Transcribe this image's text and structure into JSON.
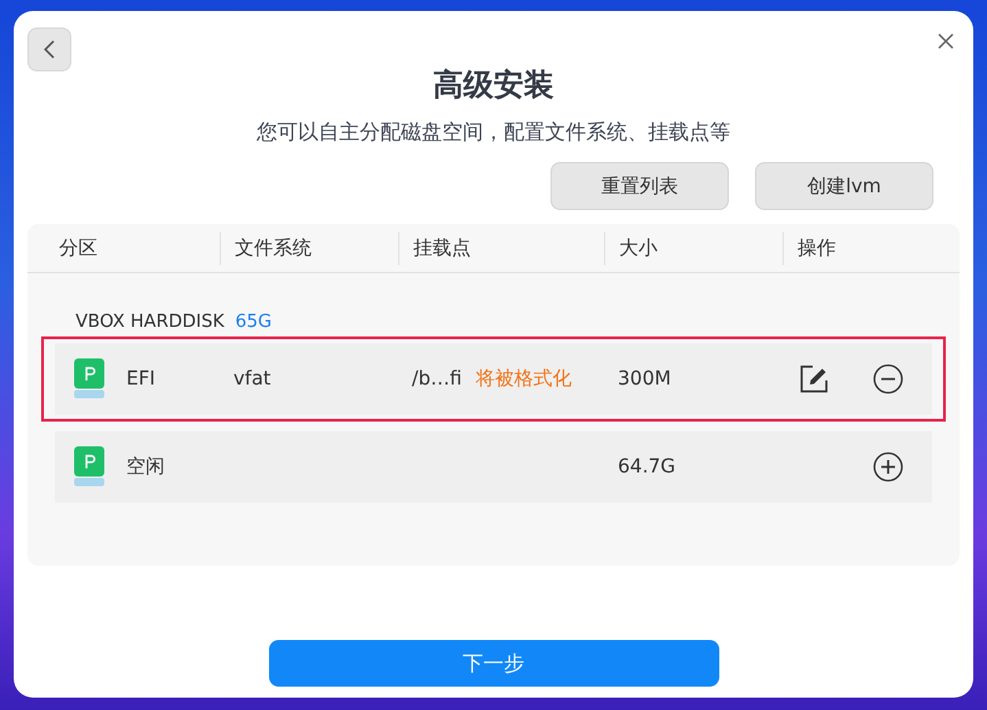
{
  "dialog": {
    "title": "高级安装",
    "subtitle": "您可以自主分配磁盘空间，配置文件系统、挂载点等",
    "toolbar_buttons": [
      "重置列表",
      "创建lvm"
    ],
    "table": {
      "columns": [
        "分区",
        "文件系统",
        "挂载点",
        "大小",
        "操作"
      ],
      "disks": [
        {
          "name": "VBOX HARDDISK",
          "size": "65G",
          "partitions": [
            {
              "kind": "partition",
              "name": "EFI",
              "filesystem": "vfat",
              "mount_point": "/b…fi",
              "format_note": "将被格式化",
              "size": "300M",
              "selected": true
            },
            {
              "kind": "free",
              "name": "空闲",
              "size": "64.7G",
              "selected": false
            }
          ]
        }
      ]
    },
    "next_button": "下一步"
  }
}
